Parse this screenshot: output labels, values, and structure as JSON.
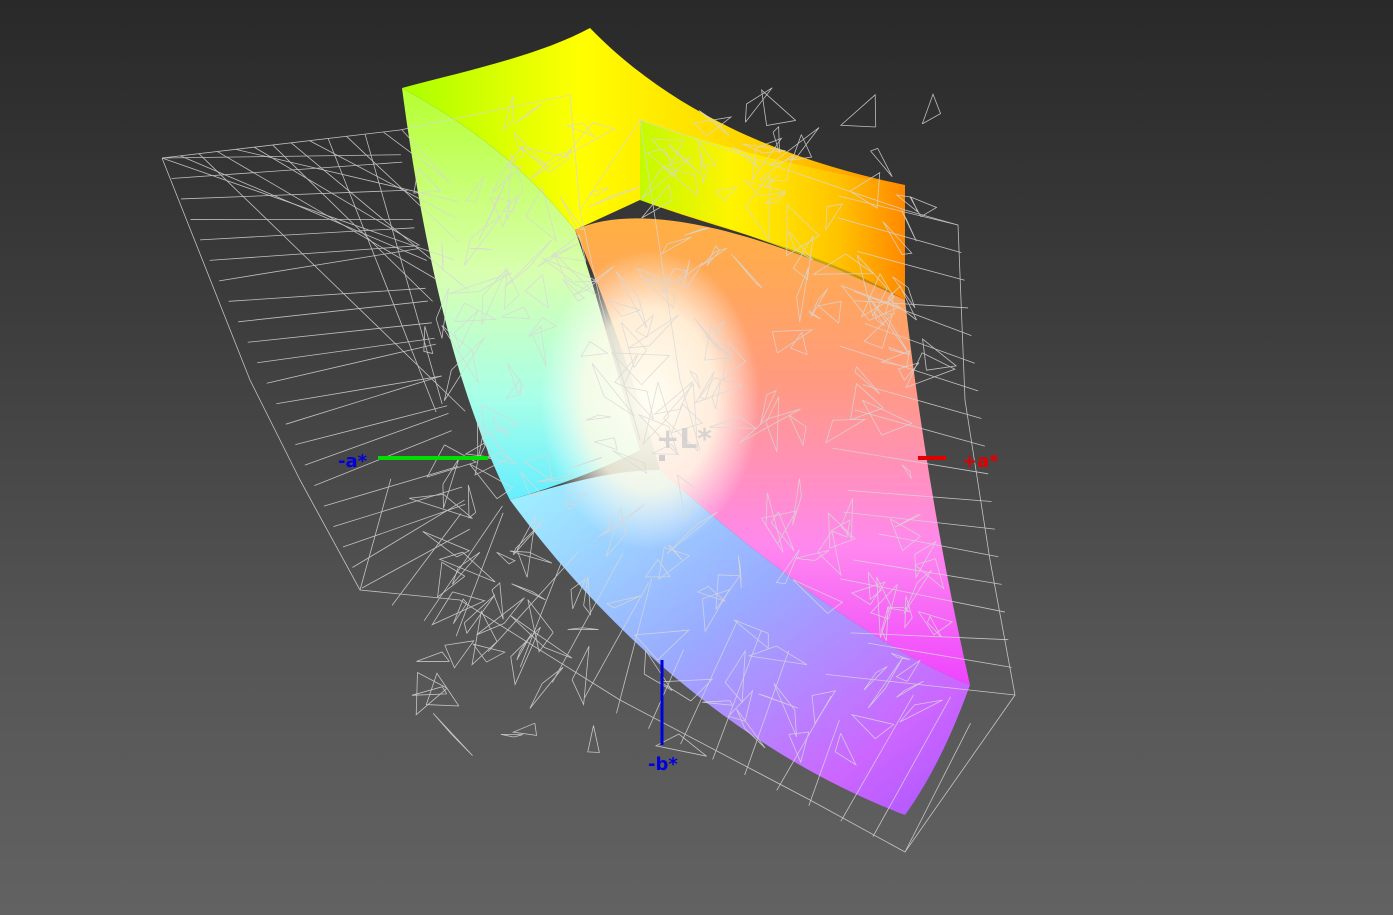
{
  "view": {
    "background_top": "#292929",
    "background_bottom": "#626262",
    "wireframe_color": "#d8d8d8"
  },
  "axes": {
    "l_label": "+L*",
    "a_pos_label": "+a*",
    "a_neg_label": "-a*",
    "b_neg_label": "-b*",
    "a_pos_color": "#e00000",
    "a_neg_color": "#00dd00",
    "b_color": "#0000dd",
    "l_color": "#cfcfcf"
  },
  "gamut": {
    "colors": {
      "green": "#aaff00",
      "yellow": "#ffff00",
      "orange": "#ff8800",
      "red": "#ff4444",
      "white": "#ffffee",
      "cyan": "#66ffee",
      "blue": "#8899ff",
      "magenta": "#ff44ff",
      "violet": "#aa55ff"
    }
  }
}
